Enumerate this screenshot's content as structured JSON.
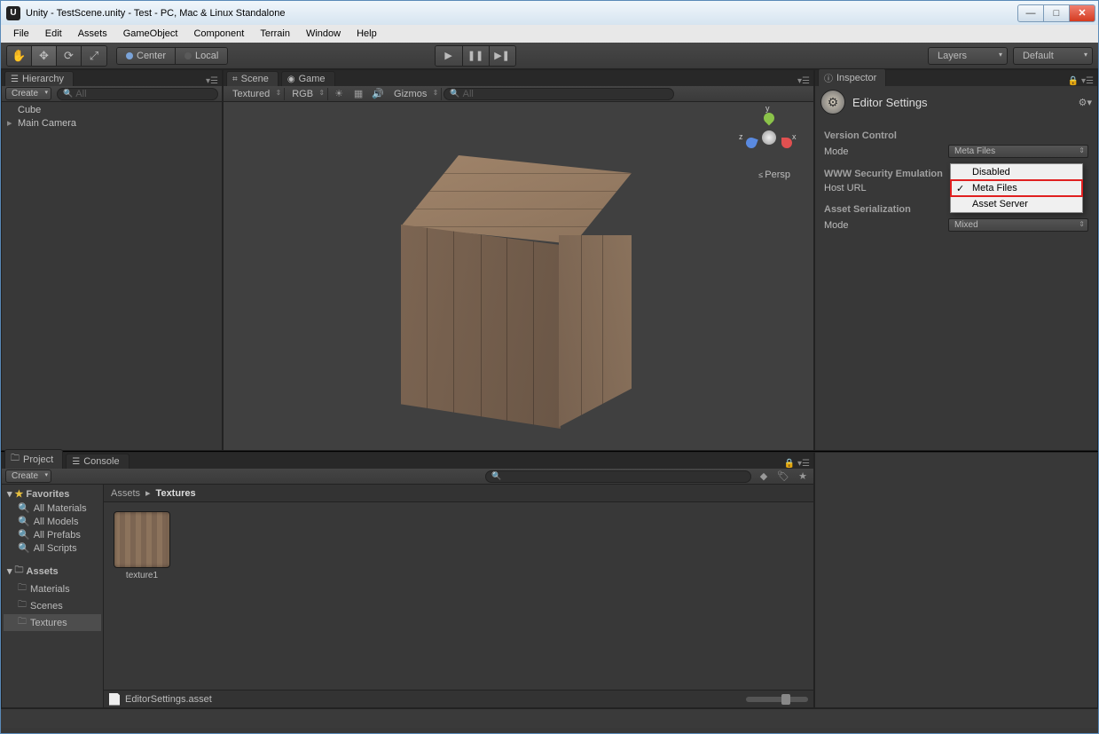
{
  "window": {
    "title": "Unity - TestScene.unity - Test - PC, Mac & Linux Standalone"
  },
  "menu": {
    "items": [
      "File",
      "Edit",
      "Assets",
      "GameObject",
      "Component",
      "Terrain",
      "Window",
      "Help"
    ]
  },
  "toolbar": {
    "pivot_center": "Center",
    "pivot_local": "Local",
    "layers": "Layers",
    "layout": "Default"
  },
  "hierarchy": {
    "tab": "Hierarchy",
    "create": "Create",
    "search_placeholder": "All",
    "items": [
      "Cube",
      "Main Camera"
    ]
  },
  "scene": {
    "tab_scene": "Scene",
    "tab_game": "Game",
    "shading": "Textured",
    "render": "RGB",
    "gizmos": "Gizmos",
    "search_placeholder": "All",
    "persp": "Persp",
    "axis_y": "y",
    "axis_x": "x",
    "axis_z": "z"
  },
  "inspector": {
    "tab": "Inspector",
    "title": "Editor Settings",
    "sections": {
      "vc_title": "Version Control",
      "vc_mode_label": "Mode",
      "vc_mode_value": "Meta Files",
      "www_title": "WWW Security Emulation",
      "www_host_label": "Host URL",
      "asset_ser_title": "Asset Serialization",
      "asset_ser_mode_label": "Mode",
      "asset_ser_mode_value": "Mixed"
    },
    "popup": {
      "items": [
        "Disabled",
        "Meta Files",
        "Asset Server"
      ],
      "checked": "Meta Files"
    }
  },
  "project": {
    "tab_project": "Project",
    "tab_console": "Console",
    "create": "Create",
    "favorites_title": "Favorites",
    "favorites": [
      "All Materials",
      "All Models",
      "All Prefabs",
      "All Scripts"
    ],
    "assets_title": "Assets",
    "asset_folders": [
      "Materials",
      "Scenes",
      "Textures"
    ],
    "selected_folder": "Textures",
    "breadcrumb_root": "Assets",
    "breadcrumb_leaf": "Textures",
    "tiles": [
      "texture1"
    ]
  },
  "statusbar": {
    "text": "EditorSettings.asset"
  }
}
